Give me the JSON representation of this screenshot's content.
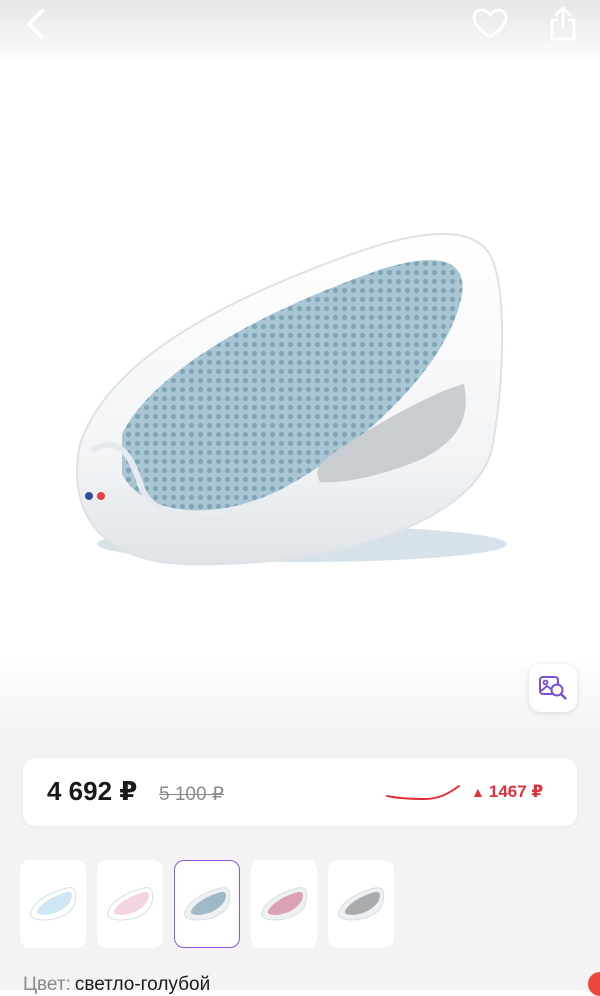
{
  "topbar": {
    "back_icon": "chevron-left-icon",
    "favorite_icon": "heart-outline-icon",
    "share_icon": "share-icon"
  },
  "hero": {
    "product_image": "light-blue baby bath seat",
    "visual_search_icon": "image-search-icon"
  },
  "price": {
    "current": "4 692 ₽",
    "old": "5 100 ₽",
    "change_direction": "up",
    "change": "1467 ₽",
    "change_color": "#e0313a"
  },
  "swatches": [
    {
      "name": "light-blue-white",
      "seat": "#cfe6f3",
      "shell": "#ffffff",
      "selected": false
    },
    {
      "name": "pink-white",
      "seat": "#f3d3e4",
      "shell": "#ffffff",
      "selected": false
    },
    {
      "name": "light-blue",
      "seat": "#9fb9c6",
      "shell": "#eef1f3",
      "selected": true
    },
    {
      "name": "pink",
      "seat": "#d9a3b3",
      "shell": "#eef1f3",
      "selected": false
    },
    {
      "name": "grey",
      "seat": "#a9abad",
      "shell": "#eef1f3",
      "selected": false
    }
  ],
  "color": {
    "label": "Цвет:",
    "value": "светло-голубой"
  },
  "accent": "#8d5bd9"
}
